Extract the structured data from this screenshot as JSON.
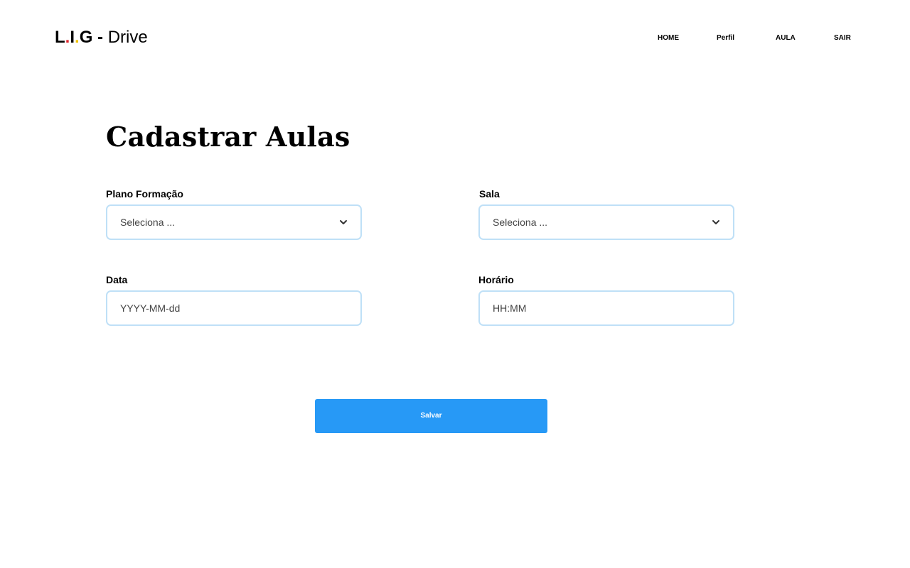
{
  "brand": {
    "l": "L",
    "dot1": ".",
    "i": "I",
    "dot2": ".",
    "g": "G",
    "separator": " - ",
    "name": "Drive",
    "dot_colors": [
      "#e0242c",
      "#f2c200"
    ]
  },
  "nav": {
    "items": [
      {
        "label": "HOME"
      },
      {
        "label": "Perfil"
      },
      {
        "label": "AULA"
      },
      {
        "label": "SAIR"
      }
    ]
  },
  "page": {
    "title": "Cadastrar Aulas"
  },
  "form": {
    "plano": {
      "label": "Plano Formação",
      "selected": "Seleciona ..."
    },
    "sala": {
      "label": "Sala",
      "selected": "Seleciona ..."
    },
    "data": {
      "label": "Data",
      "placeholder": "YYYY-MM-dd"
    },
    "horario": {
      "label": "Horário",
      "placeholder": "HH:MM"
    },
    "save_label": "Salvar"
  },
  "colors": {
    "accent": "#2799f6",
    "field_border": "#bfe0f7"
  },
  "icons": [
    "chevron-down-icon"
  ]
}
